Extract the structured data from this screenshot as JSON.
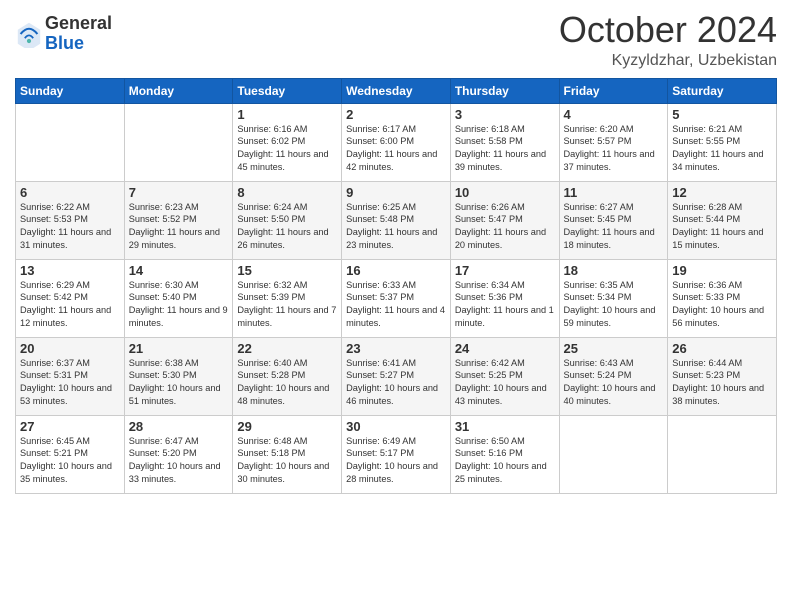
{
  "logo": {
    "general": "General",
    "blue": "Blue"
  },
  "header": {
    "month": "October 2024",
    "location": "Kyzyldzhar, Uzbekistan"
  },
  "weekdays": [
    "Sunday",
    "Monday",
    "Tuesday",
    "Wednesday",
    "Thursday",
    "Friday",
    "Saturday"
  ],
  "weeks": [
    [
      {
        "day": "",
        "sunrise": "",
        "sunset": "",
        "daylight": ""
      },
      {
        "day": "",
        "sunrise": "",
        "sunset": "",
        "daylight": ""
      },
      {
        "day": "1",
        "sunrise": "Sunrise: 6:16 AM",
        "sunset": "Sunset: 6:02 PM",
        "daylight": "Daylight: 11 hours and 45 minutes."
      },
      {
        "day": "2",
        "sunrise": "Sunrise: 6:17 AM",
        "sunset": "Sunset: 6:00 PM",
        "daylight": "Daylight: 11 hours and 42 minutes."
      },
      {
        "day": "3",
        "sunrise": "Sunrise: 6:18 AM",
        "sunset": "Sunset: 5:58 PM",
        "daylight": "Daylight: 11 hours and 39 minutes."
      },
      {
        "day": "4",
        "sunrise": "Sunrise: 6:20 AM",
        "sunset": "Sunset: 5:57 PM",
        "daylight": "Daylight: 11 hours and 37 minutes."
      },
      {
        "day": "5",
        "sunrise": "Sunrise: 6:21 AM",
        "sunset": "Sunset: 5:55 PM",
        "daylight": "Daylight: 11 hours and 34 minutes."
      }
    ],
    [
      {
        "day": "6",
        "sunrise": "Sunrise: 6:22 AM",
        "sunset": "Sunset: 5:53 PM",
        "daylight": "Daylight: 11 hours and 31 minutes."
      },
      {
        "day": "7",
        "sunrise": "Sunrise: 6:23 AM",
        "sunset": "Sunset: 5:52 PM",
        "daylight": "Daylight: 11 hours and 29 minutes."
      },
      {
        "day": "8",
        "sunrise": "Sunrise: 6:24 AM",
        "sunset": "Sunset: 5:50 PM",
        "daylight": "Daylight: 11 hours and 26 minutes."
      },
      {
        "day": "9",
        "sunrise": "Sunrise: 6:25 AM",
        "sunset": "Sunset: 5:48 PM",
        "daylight": "Daylight: 11 hours and 23 minutes."
      },
      {
        "day": "10",
        "sunrise": "Sunrise: 6:26 AM",
        "sunset": "Sunset: 5:47 PM",
        "daylight": "Daylight: 11 hours and 20 minutes."
      },
      {
        "day": "11",
        "sunrise": "Sunrise: 6:27 AM",
        "sunset": "Sunset: 5:45 PM",
        "daylight": "Daylight: 11 hours and 18 minutes."
      },
      {
        "day": "12",
        "sunrise": "Sunrise: 6:28 AM",
        "sunset": "Sunset: 5:44 PM",
        "daylight": "Daylight: 11 hours and 15 minutes."
      }
    ],
    [
      {
        "day": "13",
        "sunrise": "Sunrise: 6:29 AM",
        "sunset": "Sunset: 5:42 PM",
        "daylight": "Daylight: 11 hours and 12 minutes."
      },
      {
        "day": "14",
        "sunrise": "Sunrise: 6:30 AM",
        "sunset": "Sunset: 5:40 PM",
        "daylight": "Daylight: 11 hours and 9 minutes."
      },
      {
        "day": "15",
        "sunrise": "Sunrise: 6:32 AM",
        "sunset": "Sunset: 5:39 PM",
        "daylight": "Daylight: 11 hours and 7 minutes."
      },
      {
        "day": "16",
        "sunrise": "Sunrise: 6:33 AM",
        "sunset": "Sunset: 5:37 PM",
        "daylight": "Daylight: 11 hours and 4 minutes."
      },
      {
        "day": "17",
        "sunrise": "Sunrise: 6:34 AM",
        "sunset": "Sunset: 5:36 PM",
        "daylight": "Daylight: 11 hours and 1 minute."
      },
      {
        "day": "18",
        "sunrise": "Sunrise: 6:35 AM",
        "sunset": "Sunset: 5:34 PM",
        "daylight": "Daylight: 10 hours and 59 minutes."
      },
      {
        "day": "19",
        "sunrise": "Sunrise: 6:36 AM",
        "sunset": "Sunset: 5:33 PM",
        "daylight": "Daylight: 10 hours and 56 minutes."
      }
    ],
    [
      {
        "day": "20",
        "sunrise": "Sunrise: 6:37 AM",
        "sunset": "Sunset: 5:31 PM",
        "daylight": "Daylight: 10 hours and 53 minutes."
      },
      {
        "day": "21",
        "sunrise": "Sunrise: 6:38 AM",
        "sunset": "Sunset: 5:30 PM",
        "daylight": "Daylight: 10 hours and 51 minutes."
      },
      {
        "day": "22",
        "sunrise": "Sunrise: 6:40 AM",
        "sunset": "Sunset: 5:28 PM",
        "daylight": "Daylight: 10 hours and 48 minutes."
      },
      {
        "day": "23",
        "sunrise": "Sunrise: 6:41 AM",
        "sunset": "Sunset: 5:27 PM",
        "daylight": "Daylight: 10 hours and 46 minutes."
      },
      {
        "day": "24",
        "sunrise": "Sunrise: 6:42 AM",
        "sunset": "Sunset: 5:25 PM",
        "daylight": "Daylight: 10 hours and 43 minutes."
      },
      {
        "day": "25",
        "sunrise": "Sunrise: 6:43 AM",
        "sunset": "Sunset: 5:24 PM",
        "daylight": "Daylight: 10 hours and 40 minutes."
      },
      {
        "day": "26",
        "sunrise": "Sunrise: 6:44 AM",
        "sunset": "Sunset: 5:23 PM",
        "daylight": "Daylight: 10 hours and 38 minutes."
      }
    ],
    [
      {
        "day": "27",
        "sunrise": "Sunrise: 6:45 AM",
        "sunset": "Sunset: 5:21 PM",
        "daylight": "Daylight: 10 hours and 35 minutes."
      },
      {
        "day": "28",
        "sunrise": "Sunrise: 6:47 AM",
        "sunset": "Sunset: 5:20 PM",
        "daylight": "Daylight: 10 hours and 33 minutes."
      },
      {
        "day": "29",
        "sunrise": "Sunrise: 6:48 AM",
        "sunset": "Sunset: 5:18 PM",
        "daylight": "Daylight: 10 hours and 30 minutes."
      },
      {
        "day": "30",
        "sunrise": "Sunrise: 6:49 AM",
        "sunset": "Sunset: 5:17 PM",
        "daylight": "Daylight: 10 hours and 28 minutes."
      },
      {
        "day": "31",
        "sunrise": "Sunrise: 6:50 AM",
        "sunset": "Sunset: 5:16 PM",
        "daylight": "Daylight: 10 hours and 25 minutes."
      },
      {
        "day": "",
        "sunrise": "",
        "sunset": "",
        "daylight": ""
      },
      {
        "day": "",
        "sunrise": "",
        "sunset": "",
        "daylight": ""
      }
    ]
  ]
}
